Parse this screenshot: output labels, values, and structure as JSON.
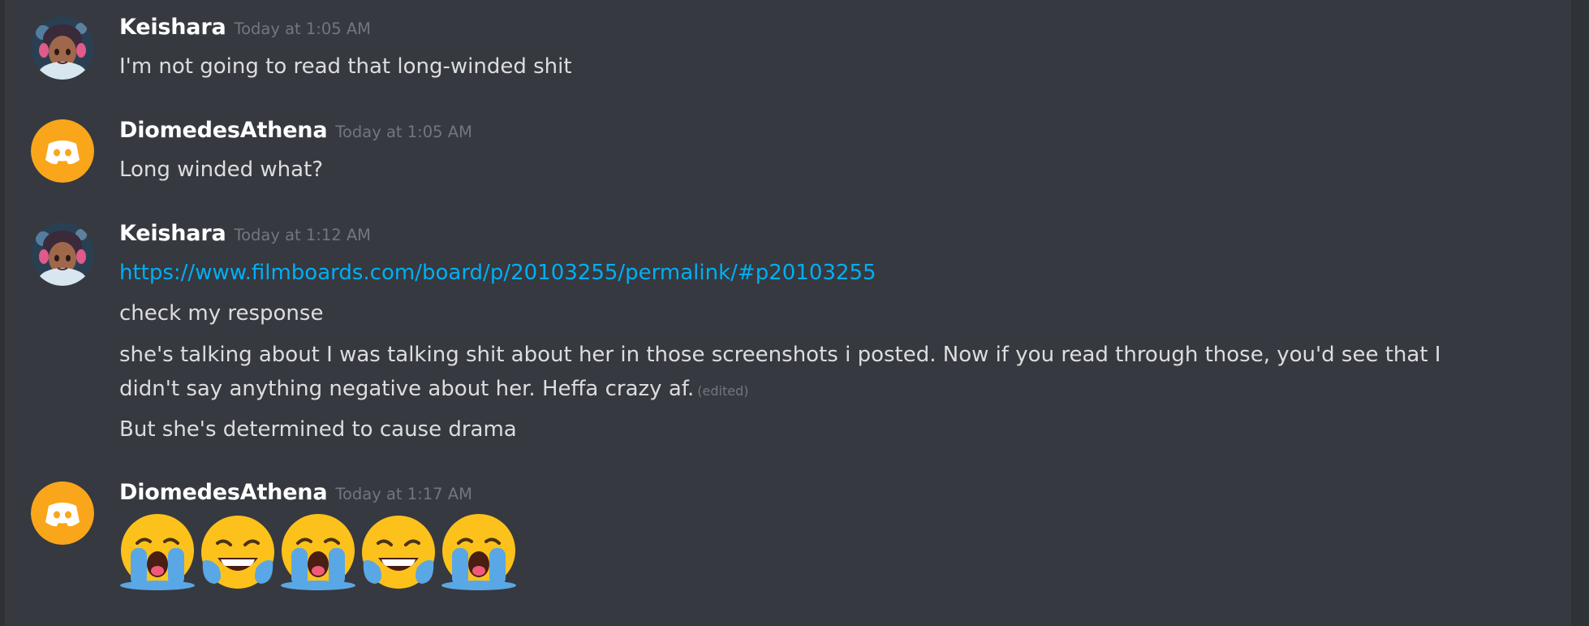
{
  "colors": {
    "background": "#36393f",
    "username": "#ffffff",
    "text": "#dcddde",
    "timestamp": "#72767d",
    "link": "#00aff4",
    "discord_default_avatar_bg": "#faa61a"
  },
  "messages": [
    {
      "author": "Keishara",
      "timestamp": "Today at 1:05 AM",
      "avatar": "anime-avatar-icon",
      "lines": [
        "I'm not going to read that long-winded shit"
      ]
    },
    {
      "author": "DiomedesAthena",
      "timestamp": "Today at 1:05 AM",
      "avatar": "discord-default-avatar-icon",
      "lines": [
        "Long winded what?"
      ]
    },
    {
      "author": "Keishara",
      "timestamp": "Today at 1:12 AM",
      "avatar": "anime-avatar-icon",
      "link": "https://www.filmboards.com/board/p/20103255/permalink/#p20103255",
      "lines": [
        "check my response",
        "she's talking about I was talking shit about her in those screenshots i posted. Now if you read through those, you'd see that I didn't say anything negative about her. Heffa crazy af.",
        "But she's determined to cause drama"
      ],
      "edited_label": "(edited)"
    },
    {
      "author": "DiomedesAthena",
      "timestamp": "Today at 1:17 AM",
      "avatar": "discord-default-avatar-icon",
      "emojis": [
        "loudly-crying-face-icon",
        "tears-of-joy-icon",
        "loudly-crying-face-icon",
        "tears-of-joy-icon",
        "loudly-crying-face-icon"
      ]
    }
  ]
}
